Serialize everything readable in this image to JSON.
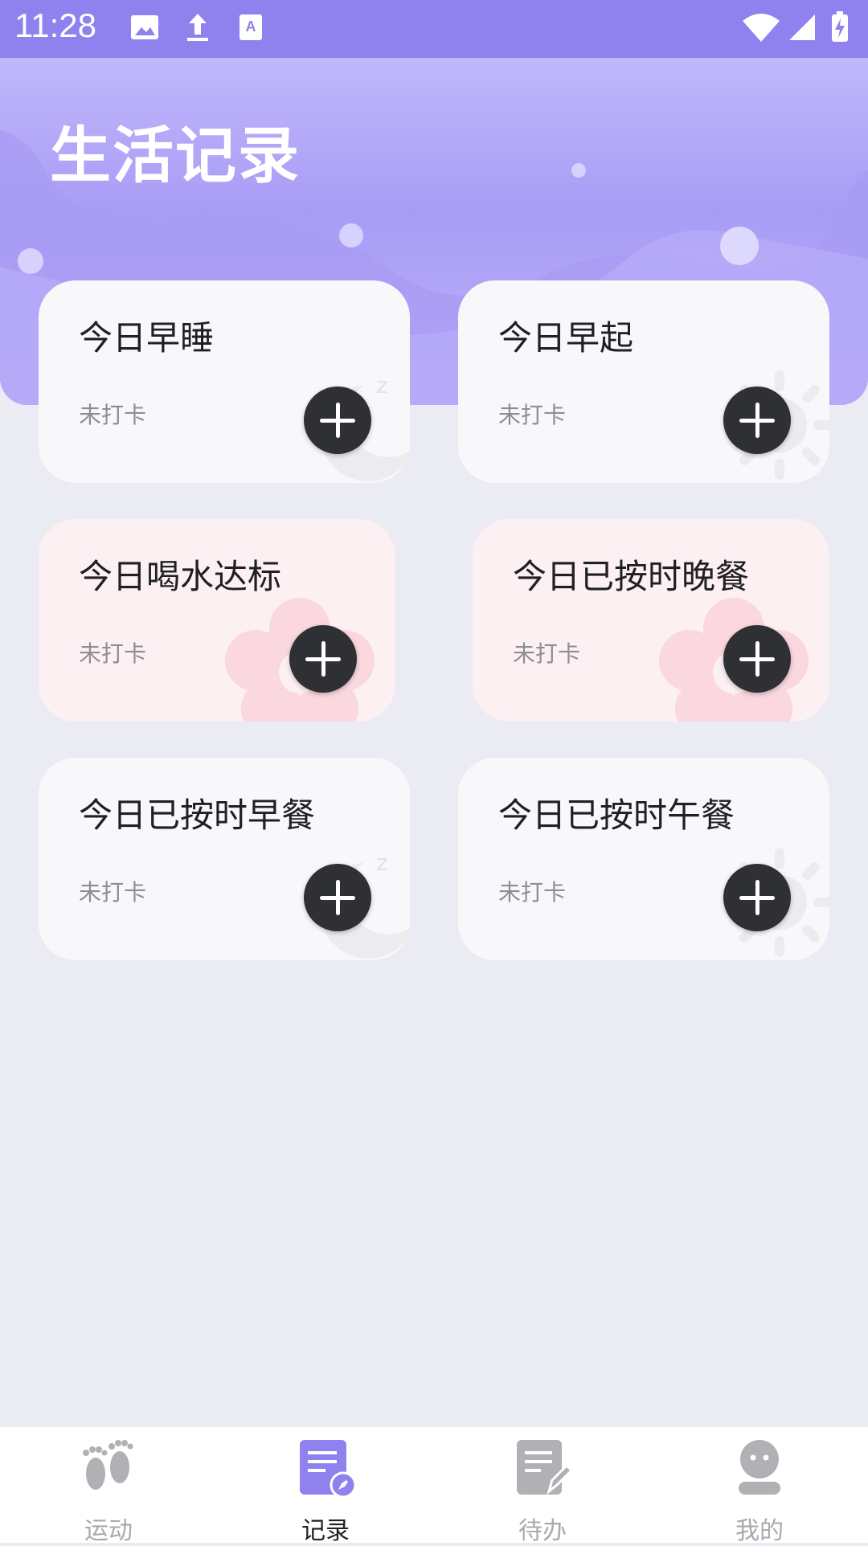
{
  "status_bar": {
    "time": "11:28",
    "left_icons": [
      "image-icon",
      "upload-icon",
      "keyboard-icon"
    ],
    "right_icons": [
      "wifi-icon",
      "signal-icon",
      "battery-charging-icon"
    ]
  },
  "header": {
    "title": "生活记录"
  },
  "cards": [
    {
      "title": "今日早睡",
      "status": "未打卡",
      "style": "white",
      "decor": "moon-icon"
    },
    {
      "title": "今日早起",
      "status": "未打卡",
      "style": "white",
      "decor": "sun-icon"
    },
    {
      "title": "今日喝水达标",
      "status": "未打卡",
      "style": "pink",
      "decor": "flower-icon"
    },
    {
      "title": "今日已按时晚餐",
      "status": "未打卡",
      "style": "pink",
      "decor": "flower-icon"
    },
    {
      "title": "今日已按时早餐",
      "status": "未打卡",
      "style": "white",
      "decor": "moon-icon"
    },
    {
      "title": "今日已按时午餐",
      "status": "未打卡",
      "style": "white",
      "decor": "sun-icon"
    }
  ],
  "bottom_nav": {
    "active_index": 1,
    "items": [
      {
        "label": "运动",
        "icon": "footprints-icon"
      },
      {
        "label": "记录",
        "icon": "record-icon"
      },
      {
        "label": "待办",
        "icon": "todo-icon"
      },
      {
        "label": "我的",
        "icon": "profile-icon"
      }
    ]
  },
  "colors": {
    "status_bar": "#8f82ee",
    "accent": "#8f82ee",
    "background": "#ebebf3",
    "add_button": "#2f3033",
    "pink_card": "#fdf0f3"
  }
}
